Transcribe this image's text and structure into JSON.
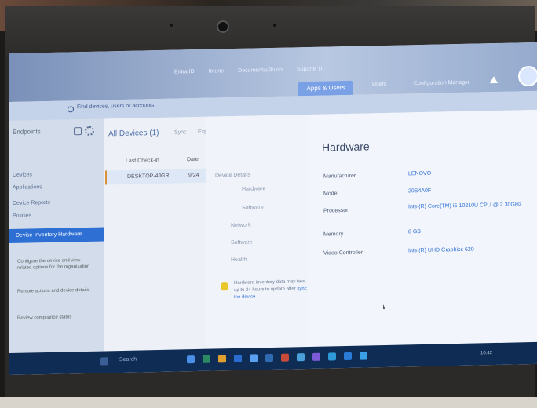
{
  "browser": {
    "bookmarks": [
      "Entra ID",
      "Intune",
      "Documentação do",
      "Suporte TI"
    ],
    "tabs": {
      "active": "Apps & Users",
      "other": [
        "Users",
        "Configuration Manager"
      ]
    }
  },
  "search": {
    "placeholder": "Find devices, users or accounts"
  },
  "sidebar": {
    "header": "Endpoints",
    "items": [
      "Devices",
      "Applications",
      "Device Reports",
      "Policies"
    ],
    "selected": "Device Inventory Hardware",
    "notes": [
      "Configure the device and view related options for the organization",
      "Remote actions and device details",
      "Review compliance status"
    ]
  },
  "devices": {
    "title": "All Devices (1)",
    "toolbar": [
      "Sync",
      "Export"
    ],
    "rows": [
      {
        "name": "Last Check-in",
        "value": "Date"
      },
      {
        "name": "DESKTOP-4JGR",
        "value": "9/24"
      }
    ]
  },
  "tree": {
    "items": [
      "Device Details",
      "Hardware",
      "Software",
      "Network",
      "Software",
      "Health"
    ]
  },
  "info": {
    "text": "Hardware inventory data may take up to 24 hours to update after",
    "link": "sync the device"
  },
  "hardware": {
    "title": "Hardware",
    "fields": [
      {
        "label": "Manufacturer",
        "value": "LENOVO"
      },
      {
        "label": "Model",
        "value": "20S4A0F"
      },
      {
        "label": "Processor",
        "value": "Intel(R) Core(TM) i5-10210U CPU @ 2.30GHz"
      },
      {
        "label": "Memory",
        "value": "8 GB"
      },
      {
        "label": "Video Controller",
        "value": "Intel(R) UHD Graphics 620"
      }
    ]
  },
  "taskbar": {
    "search": "Search",
    "time": "10:42"
  }
}
